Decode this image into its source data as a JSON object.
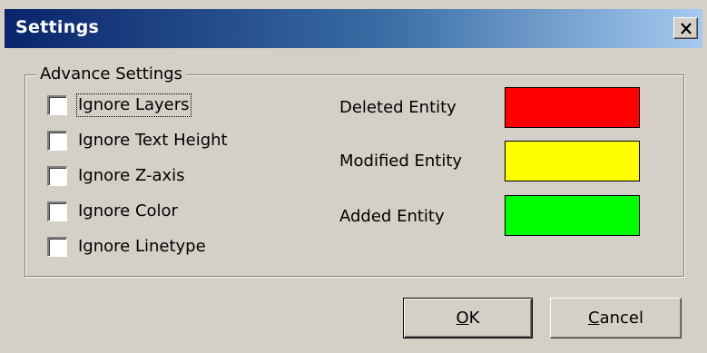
{
  "window": {
    "title": "Settings",
    "close_label": "X"
  },
  "advance_settings": {
    "legend": "Advance Settings",
    "checkboxes": [
      {
        "label": "Ignore Layers",
        "checked": false,
        "focused": true
      },
      {
        "label": "Ignore Text Height",
        "checked": false
      },
      {
        "label": "Ignore Z-axis",
        "checked": false
      },
      {
        "label": "Ignore Color",
        "checked": false
      },
      {
        "label": "Ignore Linetype",
        "checked": false
      }
    ],
    "entities": [
      {
        "label": "Deleted Entity",
        "color": "#ff0000"
      },
      {
        "label": "Modified Entity",
        "color": "#ffff00"
      },
      {
        "label": "Added Entity",
        "color": "#00ff00"
      }
    ]
  },
  "buttons": {
    "ok": {
      "label": "OK",
      "mnemonic": "O",
      "rest": "K"
    },
    "cancel": {
      "label": "Cancel",
      "mnemonic": "C",
      "rest": "ancel"
    }
  }
}
